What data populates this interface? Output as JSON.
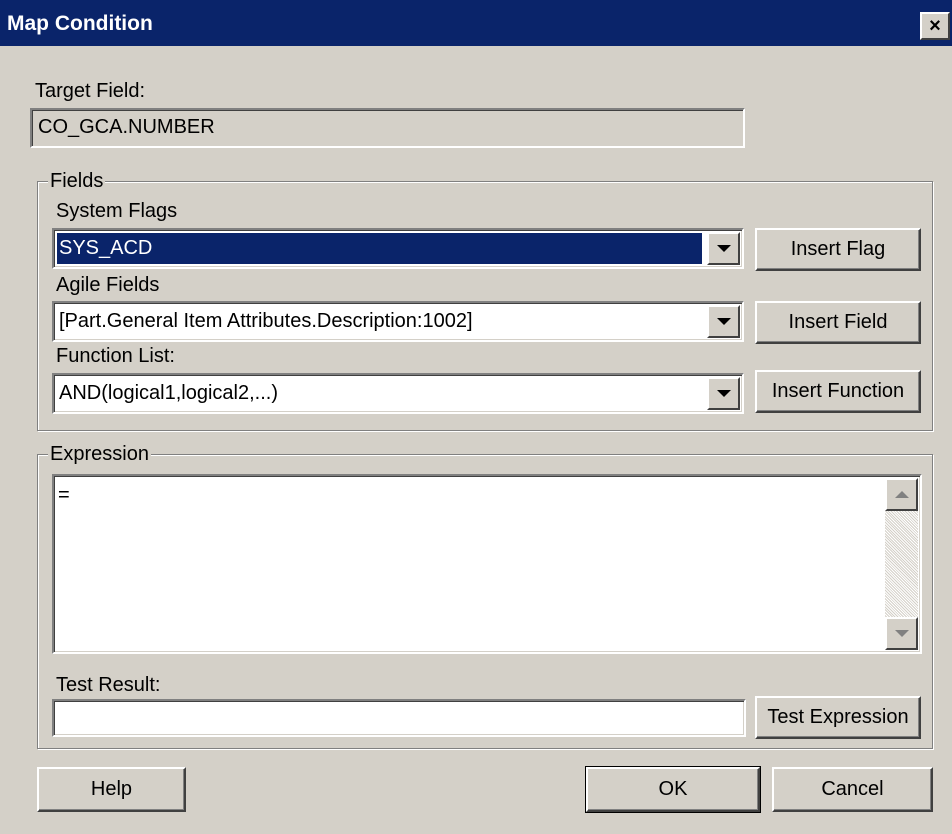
{
  "window": {
    "title": "Map Condition",
    "close_icon": "×"
  },
  "target": {
    "label": "Target Field:",
    "value": "CO_GCA.NUMBER"
  },
  "fields_group": {
    "title": "Fields",
    "system_flags": {
      "label": "System Flags",
      "selected": "SYS_ACD",
      "button": "Insert Flag"
    },
    "agile_fields": {
      "label": "Agile Fields",
      "selected": "[Part.General Item Attributes.Description:1002]",
      "button": "Insert Field"
    },
    "function_list": {
      "label": "Function List:",
      "selected": "AND(logical1,logical2,...)",
      "button": "Insert Function"
    }
  },
  "expression_group": {
    "title": "Expression",
    "value": "=",
    "test_result_label": "Test Result:",
    "test_result_value": "",
    "test_button": "Test Expression"
  },
  "footer": {
    "help": "Help",
    "ok": "OK",
    "cancel": "Cancel"
  },
  "colors": {
    "titlebar": "#0a246a",
    "dialog_bg": "#d4d0c8",
    "selection": "#0a246a"
  }
}
